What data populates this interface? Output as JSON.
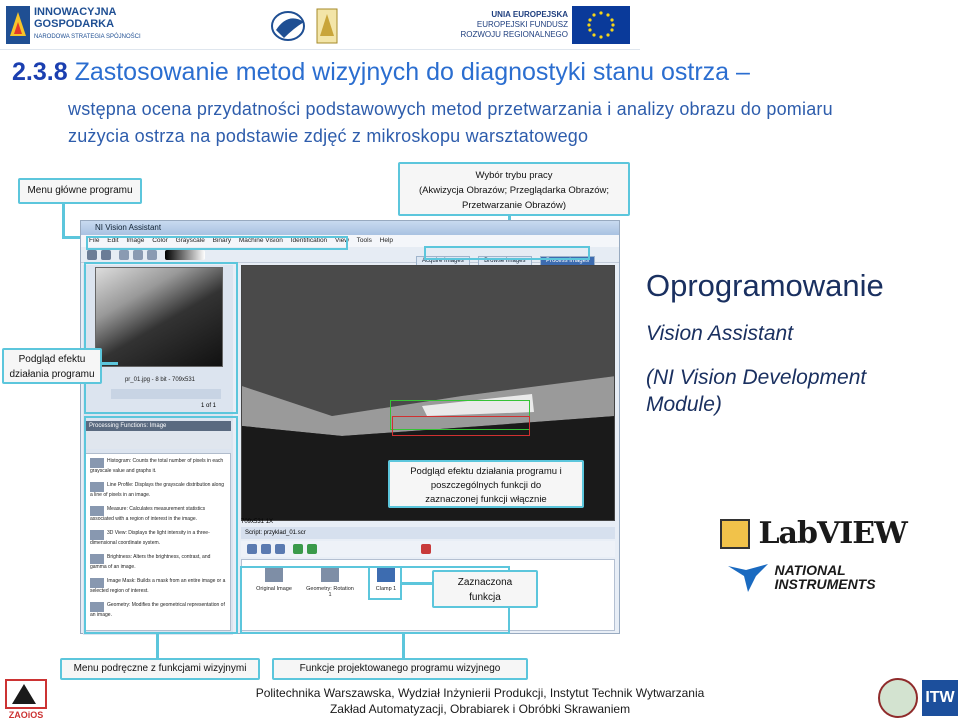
{
  "banner": {
    "ig_line1": "INNOWACYJNA",
    "ig_line2": "GOSPODARKA",
    "ig_line3": "NARODOWA STRATEGIA SPÓJNOŚCI",
    "eu_line1": "UNIA EUROPEJSKA",
    "eu_line2": "EUROPEJSKI FUNDUSZ",
    "eu_line3": "ROZWOJU REGIONALNEGO",
    "eu_flag_color": "#0a3a9a",
    "eu_star_color": "#f6d51a"
  },
  "title": {
    "number": "2.3.8",
    "text": "Zastosowanie metod wizyjnych do diagnostyki stanu ostrza –",
    "subtitle": "wstępna ocena przydatności podstawowych metod przetwarzania i analizy obrazu do pomiaru zużycia ostrza na podstawie zdjęć z mikroskopu warsztatowego"
  },
  "callouts": {
    "menu_main": "Menu główne programu",
    "mode_select": "Wybór trybu pracy\n(Akwizycja Obrazów; Przeglądarka Obrazów;\nPrzetwarzanie Obrazów)",
    "preview_effect": "Podgląd efektu\ndziałania programu",
    "preview_detail": "Podgląd efektu działania programu i\nposzczególnych funkcji do\nzaznaczonej funkcji włącznie",
    "selected_function": "Zaznaczona\nfunkcja",
    "menu_functions": "Menu podręczne z funkcjami wizyjnymi",
    "project_functions": "Funkcje projektowanego programu wizyjnego",
    "accent_color": "#5cc6dc"
  },
  "app": {
    "window_title": "NI Vision Assistant",
    "menu": [
      "File",
      "Edit",
      "Image",
      "Color",
      "Grayscale",
      "Binary",
      "Machine Vision",
      "Identification",
      "View",
      "Tools",
      "Help"
    ],
    "tabs": [
      {
        "label": "Acquire Images"
      },
      {
        "label": "Browse Images"
      },
      {
        "label": "Process Images",
        "active": true
      }
    ],
    "thumb_caption": "pr_01.jpg - 8 bit - 709x531",
    "thumb_page": "1 of 1",
    "processing_header": "Processing Functions: Image",
    "functions": [
      {
        "name": "Histogram",
        "desc": "Histogram: Counts the total number of pixels in each grayscale value and graphs it."
      },
      {
        "name": "Line Profile",
        "desc": "Line Profile: Displays the grayscale distribution along a line of pixels in an image."
      },
      {
        "name": "Measure",
        "desc": "Measure: Calculates measurement statistics associated with a region of interest in the image."
      },
      {
        "name": "3D View",
        "desc": "3D View: Displays the light intensity in a three-dimensional coordinate system."
      },
      {
        "name": "Brightness",
        "desc": "Brightness: Alters the brightness, contrast, and gamma of an image."
      },
      {
        "name": "Image Mask",
        "desc": "Image Mask: Builds a mask from an entire image or a selected region of interest."
      },
      {
        "name": "Geometry",
        "desc": "Geometry: Modifies the geometrical representation of an image."
      }
    ],
    "status": "709x531 1X",
    "script_label": "Script: przyklad_01.scr",
    "steps": [
      {
        "label": "Original Image"
      },
      {
        "label": "Geometry: Rotation 1"
      },
      {
        "label": "Clamp 1"
      }
    ]
  },
  "right": {
    "software_title": "Oprogramowanie",
    "product": "Vision Assistant",
    "module": "(NI Vision Development Module)",
    "labview_logo": "LabVIEW",
    "ni_logo_line1": "NATIONAL",
    "ni_logo_line2": "INSTRUMENTS"
  },
  "footer": {
    "line1": "Politechnika Warszawska, Wydział Inżynierii Produkcji, Instytut Technik Wytwarzania",
    "line2": "Zakład Automatyzacji, Obrabiarek i Obróbki Skrawaniem",
    "zaoios_logo": "ZAOiOS",
    "itw_logo": "ITW"
  }
}
